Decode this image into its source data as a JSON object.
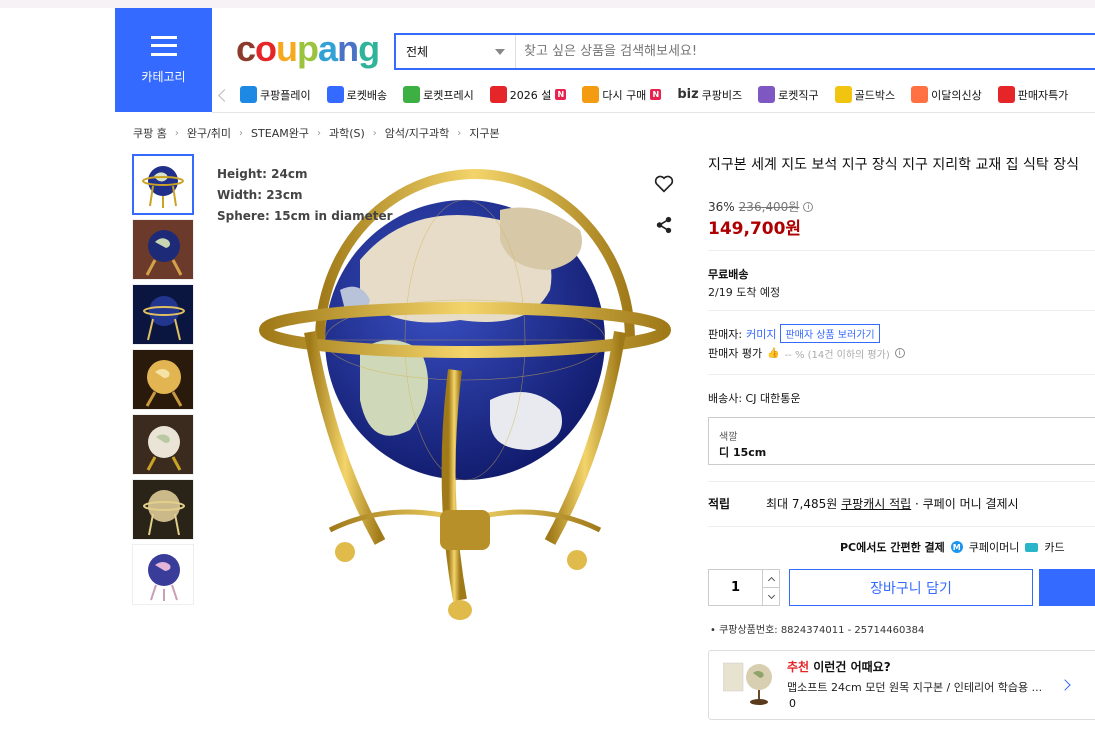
{
  "header": {
    "category_label": "카테고리",
    "logo_text": "coupang",
    "search_scope": "전체",
    "search_placeholder": "찾고 싶은 상품을 검색해보세요!"
  },
  "quick_menu": [
    {
      "label": "쿠팡플레이",
      "icon": "play-icon",
      "color": "#1e88e5"
    },
    {
      "label": "로켓배송",
      "icon": "rocket-icon",
      "color": "#346aff"
    },
    {
      "label": "로켓프레시",
      "icon": "rocket-fresh-icon",
      "color": "#3cb043"
    },
    {
      "label": "2026 설",
      "icon": "gift-icon",
      "color": "#e52528",
      "badge": "N"
    },
    {
      "label": "다시 구매",
      "icon": "reorder-icon",
      "color": "#f39c12",
      "badge": "N"
    },
    {
      "label": "쿠팡비즈",
      "icon": "biz-icon",
      "color": "#333333",
      "prefix": "biz"
    },
    {
      "label": "로켓직구",
      "icon": "global-icon",
      "color": "#7e57c2"
    },
    {
      "label": "골드박스",
      "icon": "gold-box-icon",
      "color": "#f1c40f"
    },
    {
      "label": "이달의신상",
      "icon": "new-icon",
      "color": "#ff7043"
    },
    {
      "label": "판매자특가",
      "icon": "percent-icon",
      "color": "#e52528"
    }
  ],
  "breadcrumb": [
    "쿠팡 홈",
    "완구/취미",
    "STEAM완구",
    "과학(S)",
    "암석/지구과학",
    "지구본"
  ],
  "image_specs": [
    "Height: 24cm",
    "Width: 23cm",
    "Sphere: 15cm in diameter"
  ],
  "product": {
    "title": "지구본 세계 지도 보석 지구 장식 지구 지리학 교재 집 식탁 장식",
    "discount_rate": "36%",
    "original_price": "236,400원",
    "price": "149,700원",
    "shipping_label": "무료배송",
    "arrival": "2/19 도착 예정",
    "seller_label": "판매자:",
    "seller_name": "커미지",
    "seller_link": "판매자 상품 보러가기",
    "rating_label": "판매자 평가",
    "rating_value": "-- % (14건 이하의 평가)",
    "carrier": "배송사:  CJ 대한통운",
    "option_label": "색깔",
    "option_value": "디 15cm",
    "reward_label": "적립",
    "reward_text_1": "최대 7,485원",
    "reward_link": "쿠팡캐시 적립",
    "reward_text_2": "· 쿠페이 머니 결제시",
    "pc_pay": "PC에서도 간편한 결제",
    "pay_money": "쿠페이머니",
    "pay_card": "카드",
    "quantity": "1",
    "cart_button": "장바구니 담기",
    "product_no": "• 쿠팡상품번호: 8824374011 - 25714460384"
  },
  "recommend": {
    "title_red": "추천",
    "title_rest": " 이런건 어때요?",
    "name": "맵소프트 24cm 모던 원목 지구본 / 인테리어 학습용 ...",
    "count": "0"
  },
  "colors": {
    "accent": "#346aff",
    "price": "#ae0000"
  }
}
